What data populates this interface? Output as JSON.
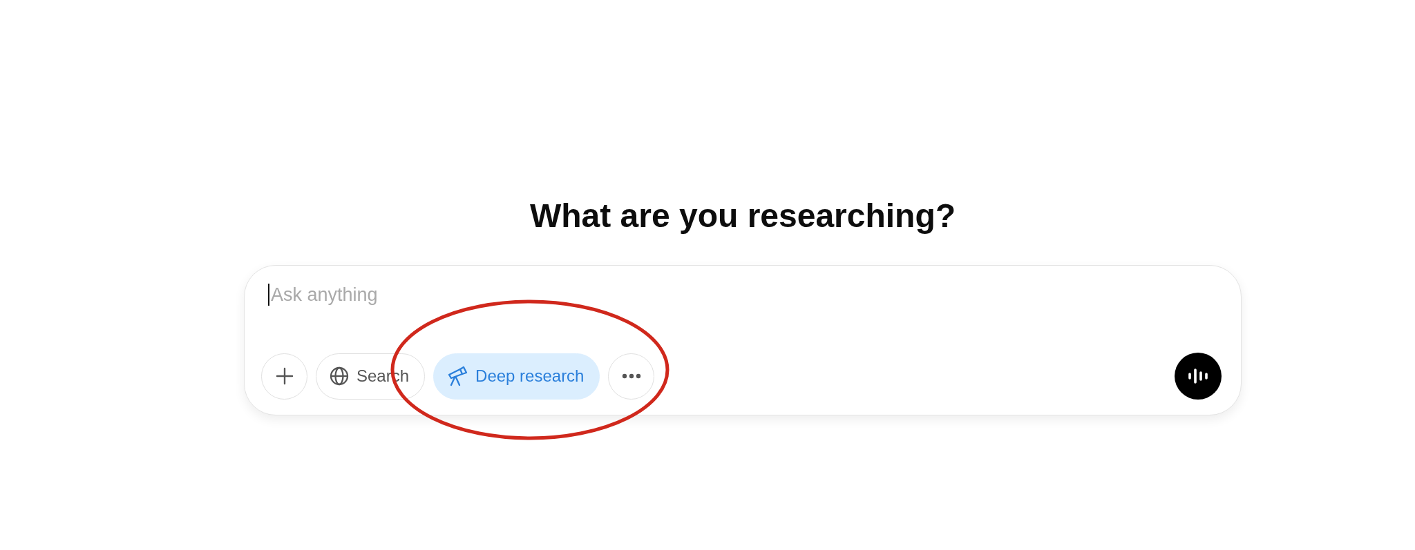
{
  "heading": "What are you researching?",
  "composer": {
    "placeholder": "Ask anything",
    "focused": true,
    "tools": [
      {
        "kind": "add",
        "selected": false
      },
      {
        "kind": "search",
        "label": "Search",
        "selected": false
      },
      {
        "kind": "deep-research",
        "label": "Deep research",
        "selected": true
      },
      {
        "kind": "more",
        "selected": false
      }
    ],
    "voice_button": {
      "kind": "voice"
    }
  },
  "annotations": [
    {
      "kind": "ellipse",
      "color": "#d0281c"
    }
  ]
}
